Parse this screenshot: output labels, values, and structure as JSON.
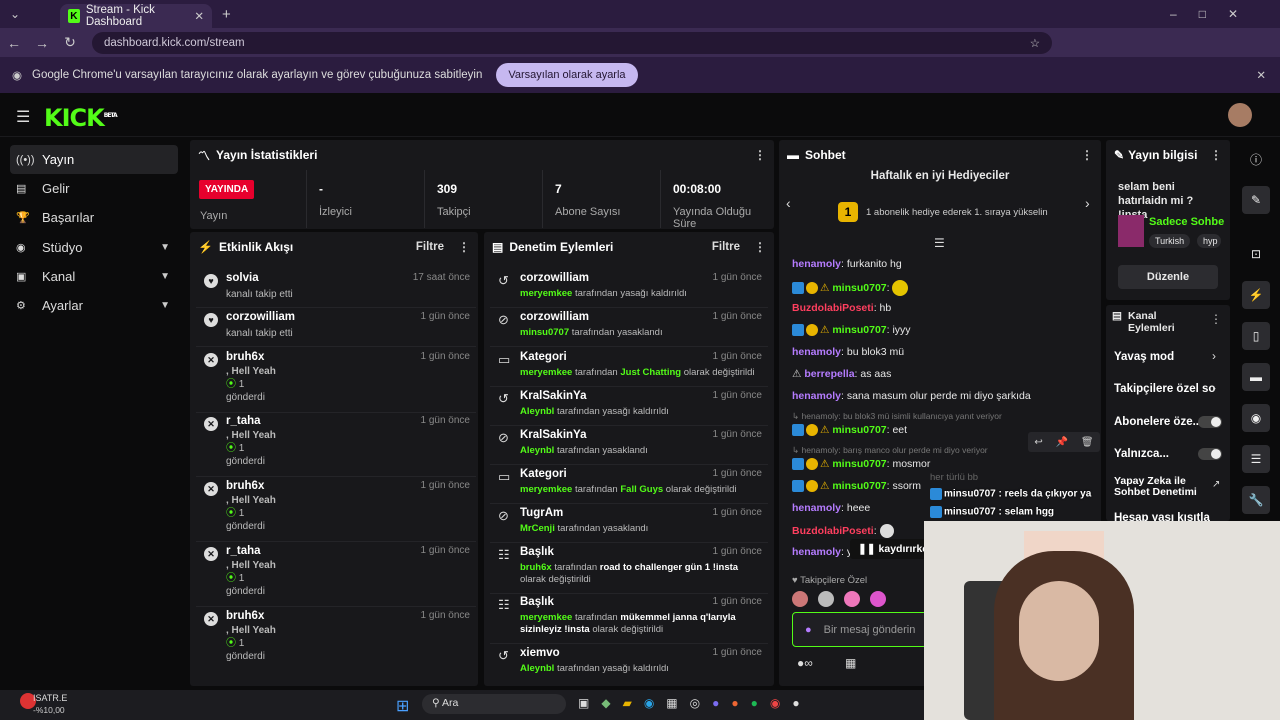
{
  "browser": {
    "tab_title": "Stream - Kick Dashboard",
    "url": "dashboard.kick.com/stream",
    "infobar_text": "Google Chrome'u varsayılan tarayıcınız olarak ayarlayın ve görev çubuğunuza sabitleyin",
    "infobar_button": "Varsayılan olarak ayarla"
  },
  "logo": "KICK",
  "logo_sup": "BETA",
  "sidebar": [
    {
      "label": "Yayın",
      "icon": "broadcast-icon"
    },
    {
      "label": "Gelir",
      "icon": "chart-icon"
    },
    {
      "label": "Başarılar",
      "icon": "trophy-icon"
    },
    {
      "label": "Stüdyo",
      "icon": "studio-icon"
    },
    {
      "label": "Kanal",
      "icon": "channel-icon"
    },
    {
      "label": "Ayarlar",
      "icon": "gear-icon"
    }
  ],
  "stats": {
    "title": "Yayın İstatistikleri",
    "live_badge": "YAYINDA",
    "live_label": "Yayın",
    "viewers": {
      "value": "-",
      "label": "İzleyici"
    },
    "followers": {
      "value": "309",
      "label": "Takipçi"
    },
    "subs": {
      "value": "7",
      "label": "Abone Sayısı"
    },
    "duration": {
      "value": "00:08:00",
      "label": "Yayında Olduğu Süre"
    }
  },
  "activity": {
    "title": "Etkinlik Akışı",
    "filter": "Filtre",
    "items": [
      {
        "name": "solvia",
        "time": "17 saat önce",
        "line1": "kanalı takip etti"
      },
      {
        "name": "corzowilliam",
        "time": "1 gün önce",
        "line1": "kanalı takip etti"
      },
      {
        "name": "bruh6x",
        "time": "1 gün önce",
        "line1": ", Hell Yeah",
        "count": "1",
        "line2": "gönderdi"
      },
      {
        "name": "r_taha",
        "time": "1 gün önce",
        "line1": ", Hell Yeah",
        "count": "1",
        "line2": "gönderdi"
      },
      {
        "name": "bruh6x",
        "time": "1 gün önce",
        "line1": ", Hell Yeah",
        "count": "1",
        "line2": "gönderdi"
      },
      {
        "name": "r_taha",
        "time": "1 gün önce",
        "line1": ", Hell Yeah",
        "count": "1",
        "line2": "gönderdi"
      },
      {
        "name": "bruh6x",
        "time": "1 gün önce",
        "line1": ", Hell Yeah",
        "count": "1",
        "line2": "gönderdi"
      }
    ]
  },
  "moderation": {
    "title": "Denetim Eylemleri",
    "filter": "Filtre",
    "items": [
      {
        "name": "corzowilliam",
        "time": "1 gün önce",
        "who": "meryemkee",
        "rest": "tarafından yasağı kaldırıldı",
        "icon": "undo-icon"
      },
      {
        "name": "corzowilliam",
        "time": "1 gün önce",
        "who": "minsu0707",
        "rest": "tarafından yasaklandı",
        "icon": "ban-icon"
      },
      {
        "name": "Kategori",
        "time": "1 gün önce",
        "who": "meryemkee",
        "rest": "tarafından",
        "hl": "Just Chatting",
        "rest2": "olarak değiştirildi",
        "icon": "category-icon"
      },
      {
        "name": "KralSakinYa",
        "time": "1 gün önce",
        "who": "Aleynbl",
        "rest": "tarafından yasağı kaldırıldı",
        "icon": "undo-icon"
      },
      {
        "name": "KralSakinYa",
        "time": "1 gün önce",
        "who": "Aleynbl",
        "rest": "tarafından yasaklandı",
        "icon": "ban-icon"
      },
      {
        "name": "Kategori",
        "time": "1 gün önce",
        "who": "meryemkee",
        "rest": "tarafından",
        "hl": "Fall Guys",
        "rest2": "olarak değiştirildi",
        "icon": "category-icon"
      },
      {
        "name": "TugrAm",
        "time": "1 gün önce",
        "who": "MrCenji",
        "rest": "tarafından yasaklandı",
        "icon": "ban-icon"
      },
      {
        "name": "Başlık",
        "time": "1 gün önce",
        "who": "bruh6x",
        "rest": "tarafından",
        "hl": "road to challenger gün 1 !insta",
        "rest2": "olarak değiştirildi",
        "icon": "title-icon"
      },
      {
        "name": "Başlık",
        "time": "1 gün önce",
        "who": "meryemkee",
        "rest": "tarafından",
        "hl": "mükemmel janna q'larıyla sizinleyiz !insta",
        "rest2": "olarak değiştirildi",
        "icon": "title-icon"
      },
      {
        "name": "xiemvo",
        "time": "1 gün önce",
        "who": "Aleynbl",
        "rest": "tarafından yasağı kaldırıldı",
        "icon": "undo-icon"
      }
    ]
  },
  "chat": {
    "title": "Sohbet",
    "gifters_title": "Haftalık en iyi Hediyeciler",
    "gifters_rank": "1",
    "gifters_text": "1 abonelik hediye ederek 1. sıraya yükselin",
    "messages": [
      {
        "user": "henamoly",
        "text": "furkanito hg",
        "c": "u1"
      },
      {
        "user": "minsu0707",
        "text": "",
        "c": "u2",
        "badges": true
      },
      {
        "user": "BuzdolabiPoseti",
        "text": "hb",
        "c": "u3"
      },
      {
        "user": "minsu0707",
        "text": "iyyy",
        "c": "u2",
        "badges": true
      },
      {
        "user": "henamoly",
        "text": "bu blok3 mü",
        "c": "u1"
      },
      {
        "user": "berrepella",
        "text": "as aas",
        "c": "u1"
      },
      {
        "user": "henamoly",
        "text": "sana masum olur perde mi diyo şarkıda",
        "c": "u1"
      },
      {
        "user": "minsu0707",
        "text": "eet",
        "c": "u2",
        "badges": true
      },
      {
        "user": "minsu0707",
        "text": "mosmor",
        "c": "u2",
        "badges": true
      },
      {
        "user": "minsu0707",
        "text": "ssorm",
        "c": "u2",
        "badges": true
      },
      {
        "user": "henamoly",
        "text": "heee",
        "c": "u1"
      },
      {
        "user": "BuzdolabiPoseti",
        "text": "",
        "c": "u3"
      },
      {
        "user": "henamoly",
        "text": "y",
        "c": "u1"
      }
    ],
    "reply1": "henamoly: bu blok3 mü isimli kullanıcıya yanıt veriyor",
    "reply2": "henamoly: barış manco olur perde mi diyo veriyor",
    "overlay1": "minsu0707 : reels da çıkıyor ya",
    "overlay2": "minsu0707 : selam hgg",
    "overlay_faded": "her türlü bb",
    "paused": "kaydırırken",
    "followers_only": "Takipçilere Özel",
    "input_placeholder": "Bir mesaj gönderin"
  },
  "stream_info": {
    "title": "Yayın bilgisi",
    "stream_title": "selam beni hatırlaidn mi ? !insta",
    "category": "Sadece Sohbe",
    "tags": [
      "Turkish",
      "hyp"
    ],
    "edit": "Düzenle"
  },
  "channel_actions": {
    "title": "Kanal Eylemleri",
    "items": [
      "Yavaş mod",
      "Takipçilere özel so",
      "Abonelere öze...",
      "Yalnızca...",
      "Yapay Zeka ile Sohbet Denetimi",
      "Hesap yaşı kısıtla"
    ]
  },
  "taskbar": {
    "stock": "ISATR.E",
    "stock_change": "-%10,00",
    "search": "Ara"
  }
}
